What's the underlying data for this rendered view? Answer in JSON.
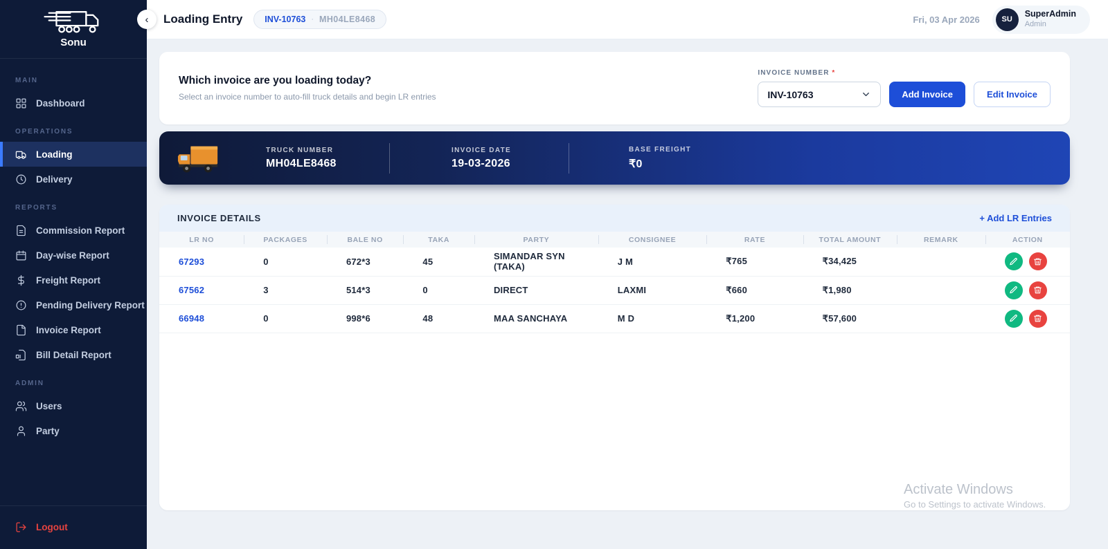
{
  "sidebar": {
    "brand": "Sonu",
    "sections": [
      {
        "label": "MAIN",
        "items": [
          {
            "label": "Dashboard"
          }
        ]
      },
      {
        "label": "OPERATIONS",
        "items": [
          {
            "label": "Loading",
            "active": true
          },
          {
            "label": "Delivery"
          }
        ]
      },
      {
        "label": "REPORTS",
        "items": [
          {
            "label": "Commission Report"
          },
          {
            "label": "Day-wise Report"
          },
          {
            "label": "Freight Report"
          },
          {
            "label": "Pending Delivery Report"
          },
          {
            "label": "Invoice Report"
          },
          {
            "label": "Bill Detail Report"
          }
        ]
      },
      {
        "label": "ADMIN",
        "items": [
          {
            "label": "Users"
          },
          {
            "label": "Party"
          }
        ]
      }
    ],
    "logout_label": "Logout"
  },
  "header": {
    "title": "Loading Entry",
    "badge": {
      "invoice": "INV-10763",
      "separator": "·",
      "truck": "MH04LE8468"
    },
    "date": "Fri, 03 Apr 2026",
    "user": {
      "initials": "SU",
      "name": "SuperAdmin",
      "role": "Admin"
    }
  },
  "invoice_card": {
    "heading": "Which invoice are you loading today?",
    "subheading": "Select an invoice number to auto-fill truck details and begin LR entries",
    "invoice_number_label": "INVOICE NUMBER",
    "required_mark": "*",
    "selected_invoice": "INV-10763",
    "add_button": "Add Invoice",
    "edit_button": "Edit Invoice"
  },
  "truck_banner": {
    "fields": [
      {
        "label": "TRUCK NUMBER",
        "value": "MH04LE8468"
      },
      {
        "label": "INVOICE DATE",
        "value": "19-03-2026"
      },
      {
        "label": "BASE FREIGHT",
        "value": "₹0"
      }
    ]
  },
  "invoice_details": {
    "title": "INVOICE DETAILS",
    "add_lr_label": "+ Add LR Entries",
    "columns": [
      "LR NO",
      "PACKAGES",
      "BALE NO",
      "TAKA",
      "PARTY",
      "CONSIGNEE",
      "RATE",
      "TOTAL AMOUNT",
      "REMARK",
      "ACTION"
    ],
    "rows": [
      {
        "lr_no": "67293",
        "packages": "0",
        "bale_no": "672*3",
        "taka": "45",
        "party": "SIMANDAR SYN (TAKA)",
        "consignee": "J M",
        "rate": "₹765",
        "total_amount": "₹34,425",
        "remark": ""
      },
      {
        "lr_no": "67562",
        "packages": "3",
        "bale_no": "514*3",
        "taka": "0",
        "party": "DIRECT",
        "consignee": "LAXMI",
        "rate": "₹660",
        "total_amount": "₹1,980",
        "remark": ""
      },
      {
        "lr_no": "66948",
        "packages": "0",
        "bale_no": "998*6",
        "taka": "48",
        "party": "MAA SANCHAYA",
        "consignee": "M D",
        "rate": "₹1,200",
        "total_amount": "₹57,600",
        "remark": ""
      }
    ]
  },
  "watermark": {
    "line1": "Activate Windows",
    "line2": "Go to Settings to activate Windows."
  },
  "icons": {
    "collapse": "‹",
    "badge_separator": "·"
  },
  "colors": {
    "sidebar_bg": "#0e1b38",
    "active_item_bg": "#1d3160",
    "accent_blue": "#1d4ed8",
    "active_border": "#3b7bff",
    "edit_green": "#10b981",
    "delete_red": "#e8433f",
    "banner_gradient_start": "#0f1a38",
    "banner_gradient_end": "#1f45b5",
    "page_bg": "#edf1f6"
  }
}
